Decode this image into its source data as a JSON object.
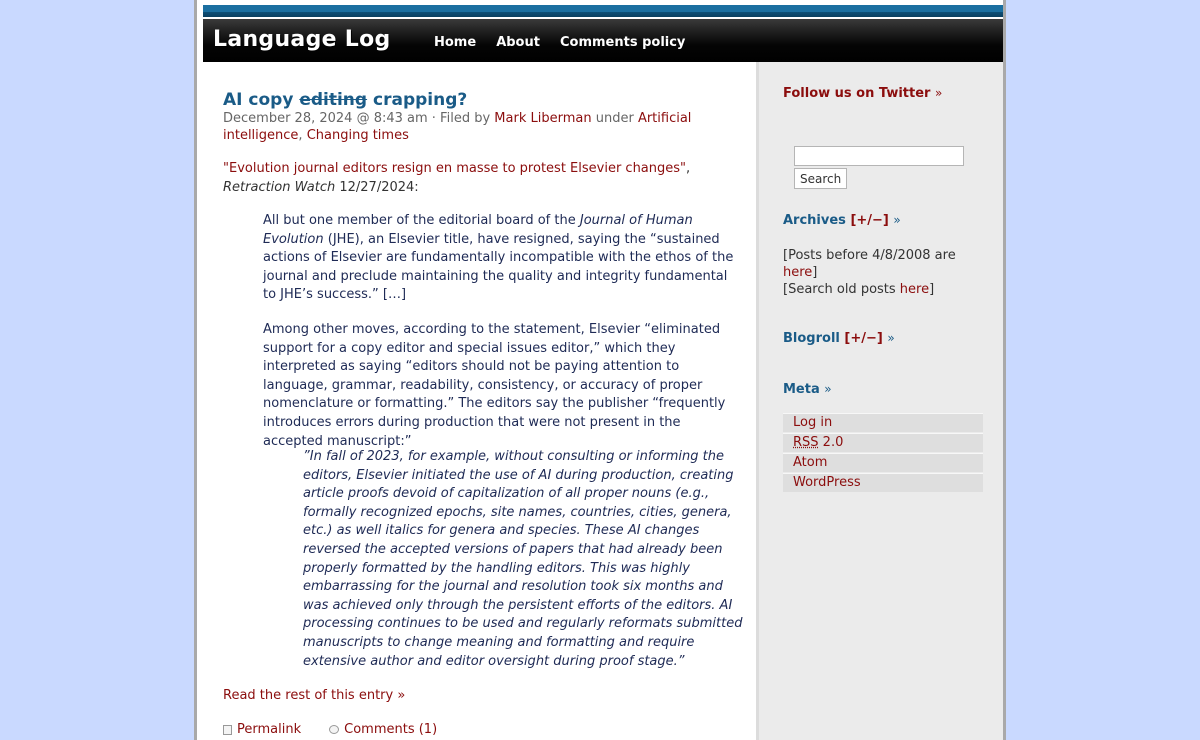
{
  "header": {
    "site_title": "Language Log",
    "nav": [
      "Home",
      "About",
      "Comments policy"
    ]
  },
  "post": {
    "title_pre": "AI copy ",
    "title_strike": "editing",
    "title_post": " crapping?",
    "date": "December 28, 2024 @ 8:43 am",
    "filed_by": "· Filed by",
    "author": "Mark Liberman",
    "under": "under",
    "category_1": "Artificial intelligence",
    "category_sep": ",",
    "category_2": "Changing times",
    "intro_link": "\"Evolution journal editors resign en masse to protest Elsevier changes\"",
    "intro_sep": ", ",
    "intro_source": "Retraction Watch",
    "intro_date": " 12/27/2024:",
    "quote1_a": "All but one member of the editorial board of the ",
    "quote1_journal": "Journal of Human Evolution",
    "quote1_b": " (JHE), an Elsevier title, have resigned, saying the “sustained actions of Elsevier are fundamentally incompatible with the ethos of the journal and preclude maintaining the quality and integrity fundamental to JHE’s success.” ",
    "quote1_more": "[…]",
    "quote2": "Among other moves, according to the statement, Elsevier “eliminated support for a copy editor and special issues editor,” which they interpreted as saying “editors should not be paying attention to language, grammar, readability, consistency, or accuracy of proper nomenclature or formatting.” The editors say the publisher “frequently introduces errors during production that were not present in the accepted manuscript:”",
    "quote3": "”In fall of 2023, for example, without consulting or informing the editors, Elsevier initiated the use of AI during production, creating article proofs devoid of capitalization of all proper nouns (e.g., formally recognized epochs, site names, countries, cities, genera, etc.) as well italics for genera and species. These AI changes reversed the accepted versions of papers that had already been properly formatted by the handling editors. This was highly embarrassing for the journal and resolution took six months and was achieved only through the persistent efforts of the editors. AI processing continues to be used and regularly reformats submitted manuscripts to change meaning and formatting and require extensive author and editor oversight during proof stage.”",
    "read_more": "Read the rest of this entry »",
    "permalink": "Permalink",
    "comments": "Comments (1)"
  },
  "sidebar": {
    "twitter": "Follow us on Twitter",
    "raquo": "»",
    "search_button": "Search",
    "search_value": "",
    "archives": "Archives",
    "toggle": "[+/−]",
    "archive_note_1a": "[Posts before 4/8/2008 are ",
    "archive_note_1_link": "here",
    "archive_note_1b": "]",
    "archive_note_2a": "[Search old posts ",
    "archive_note_2_link": "here",
    "archive_note_2b": "]",
    "blogroll": "Blogroll",
    "meta": "Meta",
    "meta_login": "Log in",
    "meta_rss_abbr": "RSS",
    "meta_rss_rest": " 2.0",
    "meta_atom": "Atom",
    "meta_wordpress": "WordPress"
  },
  "colors": {
    "page_background": "#c9d9ff",
    "title_blue": "#1a5b87",
    "link_red": "#8b0d0d",
    "quote_navy": "#1e2a55"
  }
}
